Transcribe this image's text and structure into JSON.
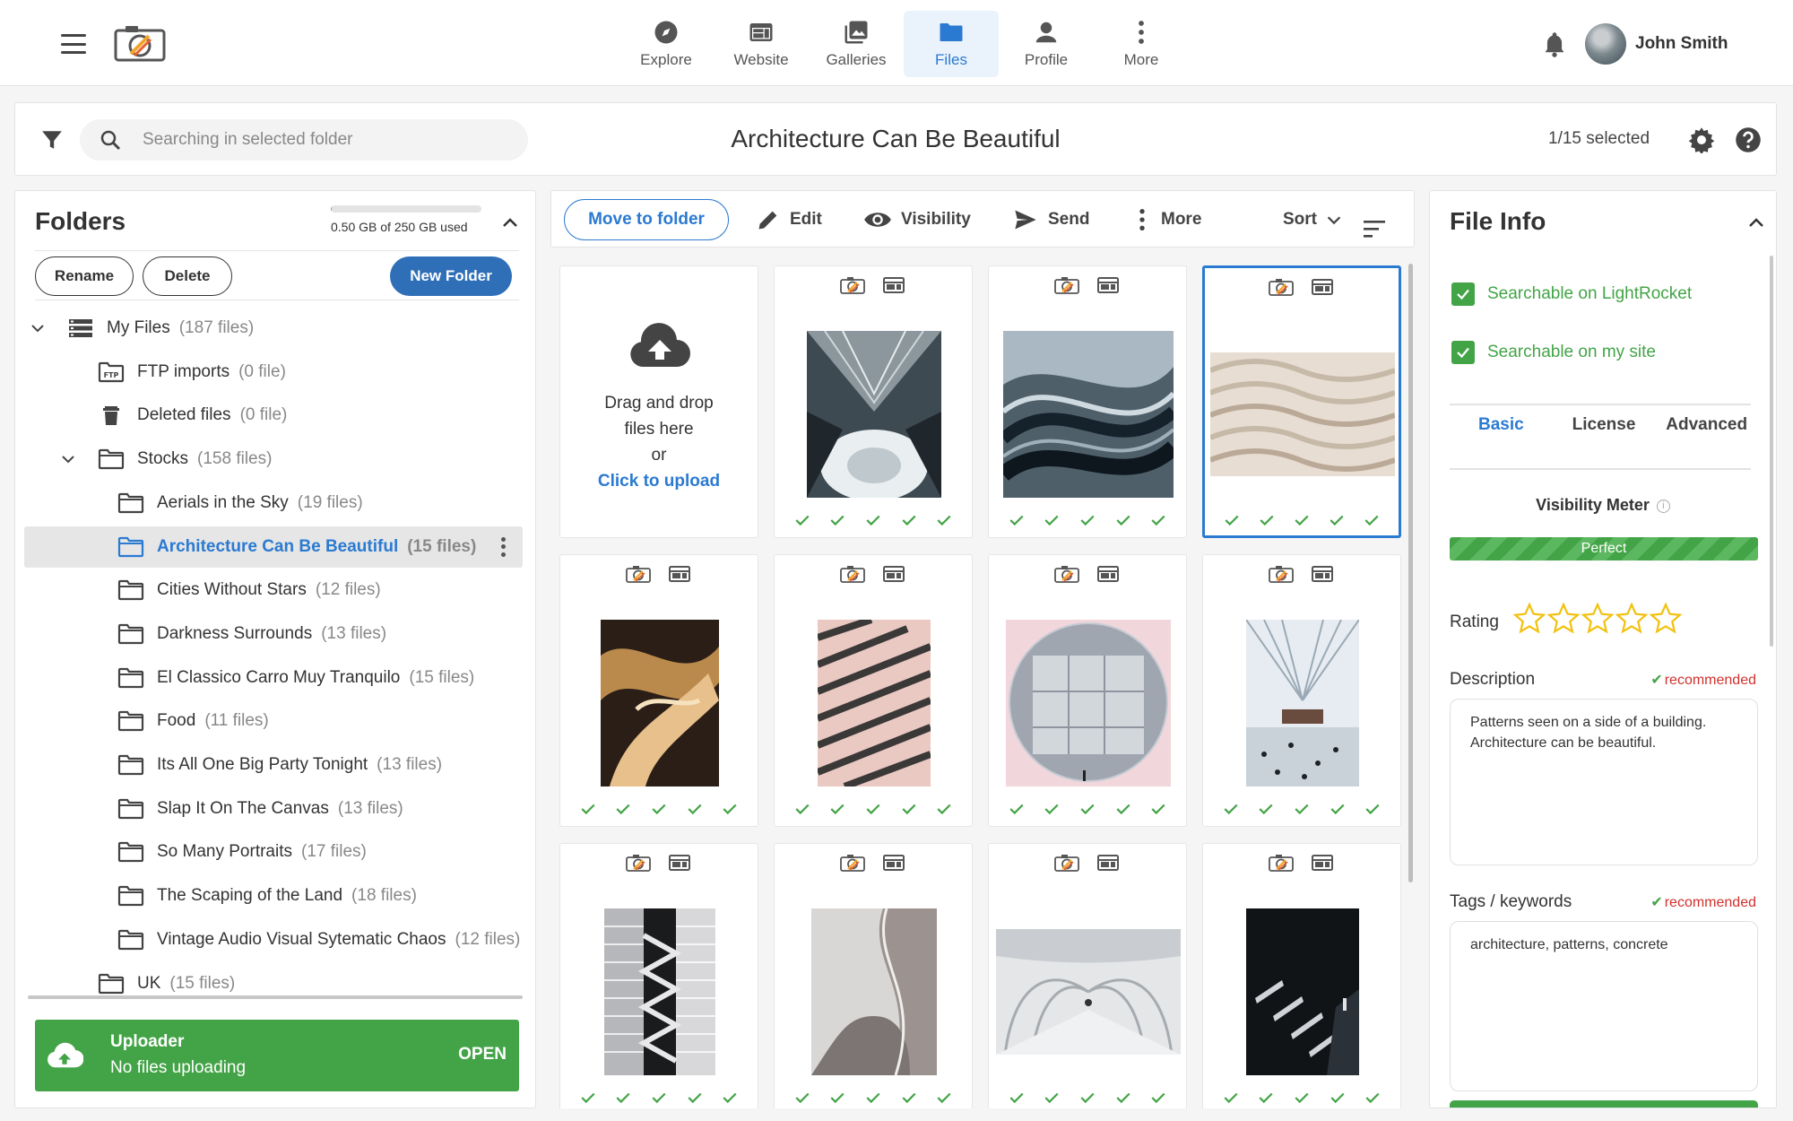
{
  "header": {
    "nav": [
      {
        "label": "Explore",
        "icon": "compass-icon"
      },
      {
        "label": "Website",
        "icon": "website-icon"
      },
      {
        "label": "Galleries",
        "icon": "galleries-icon"
      },
      {
        "label": "Files",
        "icon": "folder-icon",
        "active": true
      },
      {
        "label": "Profile",
        "icon": "person-icon"
      },
      {
        "label": "More",
        "icon": "more-vertical-icon"
      }
    ],
    "user_name": "John Smith",
    "accent_color": "#2b7ad1"
  },
  "searchbar": {
    "placeholder": "Searching in selected folder",
    "title": "Architecture Can Be Beautiful",
    "selected": "1/15 selected"
  },
  "folders": {
    "title": "Folders",
    "storage_text": "0.50 GB of 250 GB used",
    "storage_fraction": 0.002,
    "rename_label": "Rename",
    "delete_label": "Delete",
    "new_folder_label": "New Folder",
    "tree": [
      {
        "name": "My Files",
        "count": "(187 files)",
        "icon": "storage-icon",
        "level": 0,
        "expanded": true
      },
      {
        "name": "FTP imports",
        "count": "(0 file)",
        "icon": "ftp-icon",
        "level": 1
      },
      {
        "name": "Deleted files",
        "count": "(0 file)",
        "icon": "trash-icon",
        "level": 1
      },
      {
        "name": "Stocks",
        "count": "(158 files)",
        "icon": "folder-icon",
        "level": 1,
        "expanded": true
      },
      {
        "name": "Aerials in the Sky",
        "count": "(19 files)",
        "icon": "folder-icon",
        "level": 2
      },
      {
        "name": "Architecture Can Be Beautiful",
        "count": "(15 files)",
        "icon": "folder-icon",
        "level": 2,
        "selected": true
      },
      {
        "name": "Cities Without Stars",
        "count": "(12 files)",
        "icon": "folder-icon",
        "level": 2
      },
      {
        "name": "Darkness Surrounds",
        "count": "(13 files)",
        "icon": "folder-icon",
        "level": 2
      },
      {
        "name": "El Classico Carro Muy Tranquilo",
        "count": "(15 files)",
        "icon": "folder-icon",
        "level": 2
      },
      {
        "name": "Food",
        "count": "(11 files)",
        "icon": "folder-icon",
        "level": 2
      },
      {
        "name": "Its All One Big Party Tonight",
        "count": "(13 files)",
        "icon": "folder-icon",
        "level": 2
      },
      {
        "name": "Slap It On The Canvas",
        "count": "(13 files)",
        "icon": "folder-icon",
        "level": 2
      },
      {
        "name": "So Many Portraits",
        "count": "(17 files)",
        "icon": "folder-icon",
        "level": 2
      },
      {
        "name": "The Scaping of the Land",
        "count": "(18 files)",
        "icon": "folder-icon",
        "level": 2
      },
      {
        "name": "Vintage Audio Visual Sytematic Chaos",
        "count": "(12 files)",
        "icon": "folder-icon",
        "level": 2
      },
      {
        "name": "UK",
        "count": "(15 files)",
        "icon": "folder-icon",
        "level": 1
      }
    ],
    "uploader": {
      "title": "Uploader",
      "status": "No files uploading",
      "action": "OPEN"
    }
  },
  "toolbar": {
    "move_label": "Move to folder",
    "edit_label": "Edit",
    "visibility_label": "Visibility",
    "send_label": "Send",
    "more_label": "More",
    "sort_label": "Sort"
  },
  "upload_tile": {
    "line1": "Drag and drop",
    "line2": "files here",
    "line3": "or",
    "link": "Click to upload"
  },
  "files": [
    {
      "thumb": "arch-white-atrium",
      "selected": false
    },
    {
      "thumb": "arch-blue-spiral",
      "selected": false
    },
    {
      "thumb": "arch-concrete-pattern",
      "selected": true
    },
    {
      "thumb": "arch-gold-swirl",
      "selected": false
    },
    {
      "thumb": "arch-pink-balconies",
      "selected": false
    },
    {
      "thumb": "arch-circle-window",
      "selected": false
    },
    {
      "thumb": "arch-oculus-hall",
      "selected": false
    },
    {
      "thumb": "arch-stair-facade",
      "selected": false
    },
    {
      "thumb": "arch-curved-wall",
      "selected": false
    },
    {
      "thumb": "arch-white-corridor",
      "selected": false
    },
    {
      "thumb": "arch-dark-stairs",
      "selected": false
    }
  ],
  "file_info": {
    "title": "File Info",
    "searchable_lightrocket": "Searchable on LightRocket",
    "searchable_site": "Searchable on my site",
    "tabs": [
      "Basic",
      "License",
      "Advanced"
    ],
    "active_tab": "Basic",
    "visibility_meter_label": "Visibility Meter",
    "visibility_meter_value": "Perfect",
    "rating_label": "Rating",
    "rating": 0,
    "rating_max": 5,
    "description_label": "Description",
    "recommended": "recommended",
    "description": "Patterns seen on a side of a building. Architecture can be beautiful.",
    "tags_label": "Tags / keywords",
    "tags": "architecture, patterns, concrete",
    "success_color": "#43a447",
    "warning_color": "#d0312d"
  }
}
